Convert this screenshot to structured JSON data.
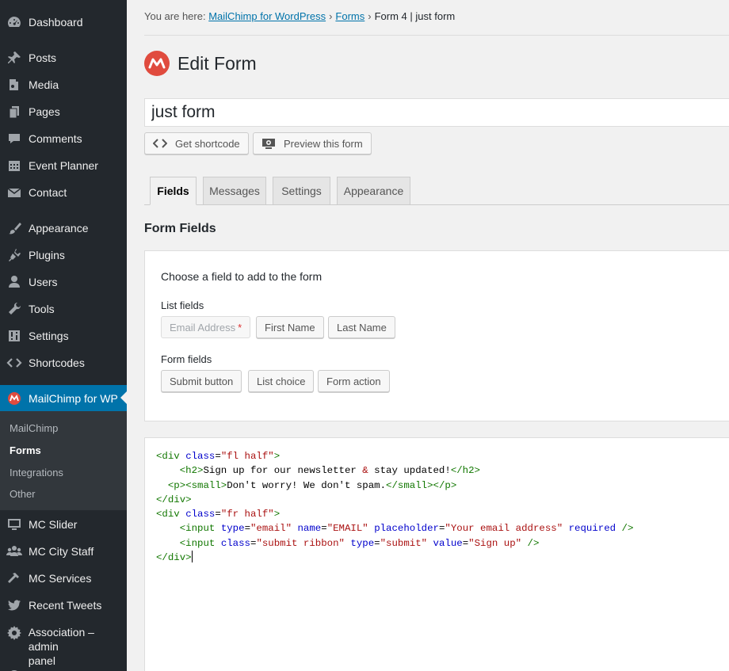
{
  "sidebar": {
    "items": [
      {
        "label": "Dashboard",
        "icon": "dashboard-icon"
      },
      {
        "label": "Posts",
        "icon": "pin-icon"
      },
      {
        "label": "Media",
        "icon": "media-icon"
      },
      {
        "label": "Pages",
        "icon": "pages-icon"
      },
      {
        "label": "Comments",
        "icon": "comment-icon"
      },
      {
        "label": "Event Planner",
        "icon": "calendar-icon"
      },
      {
        "label": "Contact",
        "icon": "envelope-icon"
      },
      {
        "label": "Appearance",
        "icon": "brush-icon"
      },
      {
        "label": "Plugins",
        "icon": "plugin-icon"
      },
      {
        "label": "Users",
        "icon": "user-icon"
      },
      {
        "label": "Tools",
        "icon": "wrench-icon"
      },
      {
        "label": "Settings",
        "icon": "sliders-icon"
      },
      {
        "label": "Shortcodes",
        "icon": "code-icon"
      },
      {
        "label": "MailChimp for WP",
        "icon": "mailchimp-icon"
      },
      {
        "label": "MC Slider",
        "icon": "monitor-icon"
      },
      {
        "label": "MC City Staff",
        "icon": "group-icon"
      },
      {
        "label": "MC Services",
        "icon": "hammer-icon"
      },
      {
        "label": "Recent Tweets",
        "icon": "twitter-icon"
      },
      {
        "label": "Association – admin",
        "label2": "panel",
        "icon": "gear-icon"
      }
    ],
    "submenu": [
      "MailChimp",
      "Forms",
      "Integrations",
      "Other"
    ]
  },
  "breadcrumb": {
    "prefix": "You are here:",
    "link1": "MailChimp for WordPress",
    "link2": "Forms",
    "current": "Form 4 | just form",
    "separator": "›"
  },
  "page": {
    "title": "Edit Form",
    "form_name": "just form"
  },
  "buttons": {
    "shortcode": "Get shortcode",
    "preview": "Preview this form"
  },
  "tabs": [
    "Fields",
    "Messages",
    "Settings",
    "Appearance"
  ],
  "section_title": "Form Fields",
  "field_box": {
    "heading": "Choose a field to add to the form",
    "list_fields_label": "List fields",
    "list_fields": [
      "Email Address",
      "First Name",
      "Last Name"
    ],
    "required_marker": "*",
    "form_fields_label": "Form fields",
    "form_fields": [
      "Submit button",
      "List choice",
      "Form action"
    ]
  },
  "code": {
    "l1_tag": "<div",
    "l1_attr": "class",
    "l1_val": "\"fl half\"",
    "l1_end": ">",
    "l2_open": "<h2>",
    "l2_text1": "Sign up for our newsletter ",
    "l2_amp": "&",
    "l2_text2": " stay updated!",
    "l2_close": "</h2>",
    "l3_p": "<p>",
    "l3_small": "<small>",
    "l3_text": "Don't worry! We don't spam.",
    "l3_small_close": "</small>",
    "l3_p_close": "</p>",
    "l4": "</div>",
    "l5_tag": "<div",
    "l5_attr": "class",
    "l5_val": "\"fr half\"",
    "l5_end": ">",
    "l6_tag": "<input",
    "l6_a1": "type",
    "l6_v1": "\"email\"",
    "l6_a2": "name",
    "l6_v2": "\"EMAIL\"",
    "l6_a3": "placeholder",
    "l6_v3": "\"Your email address\"",
    "l6_a4": "required",
    "l6_end": "/>",
    "l7_tag": "<input",
    "l7_a1": "class",
    "l7_v1": "\"submit ribbon\"",
    "l7_a2": "type",
    "l7_v2": "\"submit\"",
    "l7_a3": "value",
    "l7_v3": "\"Sign up\"",
    "l7_end": "/>",
    "l8": "</div>"
  },
  "colors": {
    "sidebar_bg": "#23282d",
    "active_bg": "#0073aa",
    "link": "#0073aa",
    "mailchimp_red": "#e04b3e"
  }
}
